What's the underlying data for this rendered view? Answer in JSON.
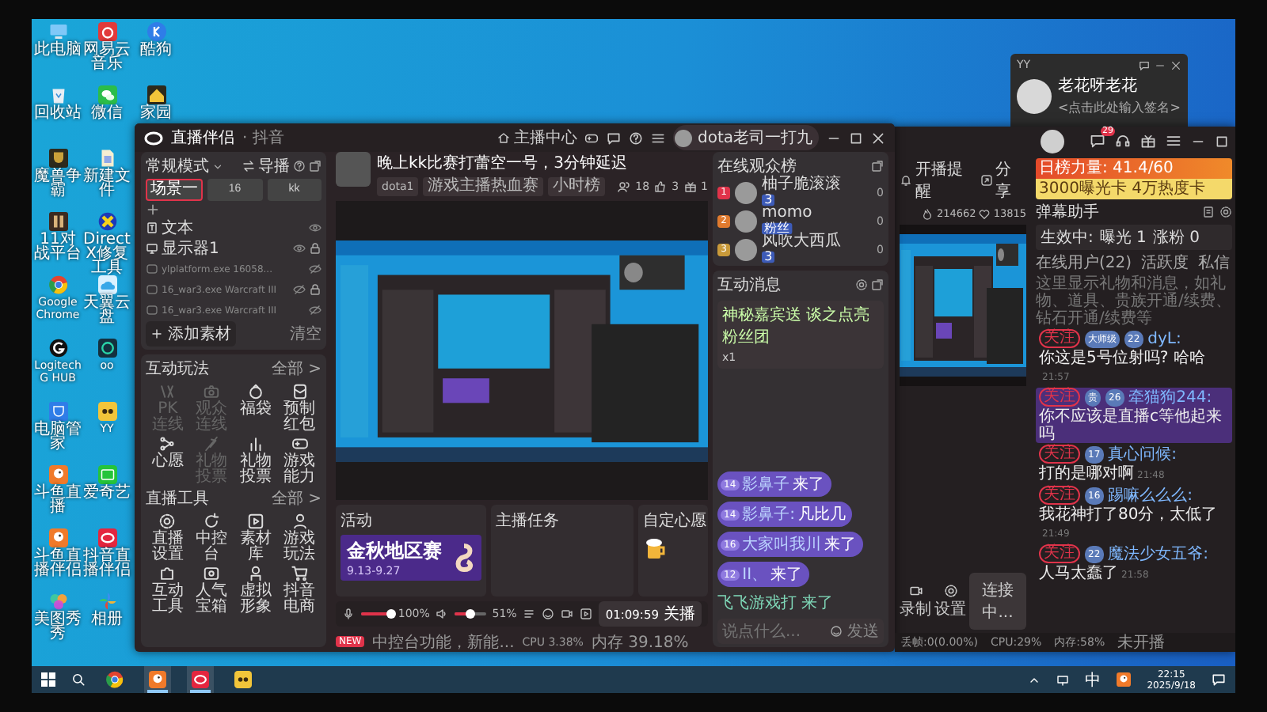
{
  "desktop": {
    "icons": [
      {
        "label": "此电脑",
        "kind": "computer"
      },
      {
        "label": "回收站",
        "kind": "bin"
      },
      {
        "label": "魔兽争霸",
        "kind": "shieldgame"
      },
      {
        "label": "11对战平台",
        "kind": "tile"
      },
      {
        "label": "Google Chrome",
        "kind": "browser"
      },
      {
        "label": "Logitech G HUB",
        "kind": "roundlogo"
      },
      {
        "label": "电脑管家",
        "kind": "guard"
      },
      {
        "label": "斗鱼直播",
        "kind": "bird"
      },
      {
        "label": "斗鱼直播伴侣",
        "kind": "bird"
      },
      {
        "label": "美图秀秀",
        "kind": "petal"
      },
      {
        "label": "网易云音乐",
        "kind": "music"
      },
      {
        "label": "微信",
        "kind": "chat"
      },
      {
        "label": "新建文件",
        "kind": "file"
      },
      {
        "label": "DirectX修复工具",
        "kind": "cross"
      },
      {
        "label": "天翼云盘",
        "kind": "cloud"
      },
      {
        "label": "oo",
        "kind": "ring"
      },
      {
        "label": "YY",
        "kind": "animal"
      },
      {
        "label": "爱奇艺",
        "kind": "tv"
      },
      {
        "label": "抖音直播伴侣",
        "kind": "oval"
      },
      {
        "label": "相册",
        "kind": "pinwheel"
      },
      {
        "label": "酷狗",
        "kind": "badge"
      },
      {
        "label": "家园",
        "kind": "house"
      }
    ]
  },
  "profile_card": {
    "app": "YY",
    "name": "老花呀老花",
    "signature": "<点击此处输入签名>"
  },
  "main_window": {
    "app_title": "直播伴侣",
    "platform": "· 抖音",
    "anchor_center": "主播中心",
    "user": "dota老司一打九",
    "scenes": {
      "mode": "常规模式",
      "director": "导播",
      "tabs": [
        {
          "label": "场景一",
          "selected": true
        },
        {
          "label": "16",
          "selected": false
        },
        {
          "label": "kk",
          "selected": false
        }
      ],
      "sources": [
        {
          "kind": "text",
          "label": "文本",
          "visible": true,
          "locked": false
        },
        {
          "kind": "display",
          "label": "显示器1",
          "visible": true,
          "locked": true
        },
        {
          "kind": "window",
          "label": "ylplatform.exe 16058...",
          "visible": false,
          "locked": false
        },
        {
          "kind": "window",
          "label": "16_war3.exe Warcraft III",
          "visible": false,
          "locked": true
        },
        {
          "kind": "window",
          "label": "16_war3.exe Warcraft III",
          "visible": false,
          "locked": false
        }
      ],
      "add": "添加素材",
      "clear": "清空"
    },
    "interactive": {
      "title": "互动玩法",
      "more": "全部 >",
      "tools": [
        {
          "label": "PK连线",
          "kind": "versus",
          "disabled": true
        },
        {
          "label": "观众连线",
          "kind": "camera",
          "disabled": true
        },
        {
          "label": "福袋",
          "kind": "bag",
          "disabled": false
        },
        {
          "label": "预制红包",
          "kind": "envelope",
          "disabled": false
        },
        {
          "label": "心愿",
          "kind": "network",
          "disabled": false
        },
        {
          "label": "礼物投票",
          "kind": "quill",
          "disabled": true
        },
        {
          "label": "礼物投票",
          "kind": "bars",
          "disabled": false
        },
        {
          "label": "游戏能力",
          "kind": "gamepad",
          "disabled": false
        }
      ]
    },
    "live_tools": {
      "title": "直播工具",
      "more": "全部 >",
      "tools": [
        {
          "label": "直播设置",
          "kind": "gear",
          "disabled": false
        },
        {
          "label": "中控台",
          "kind": "refresh",
          "disabled": false
        },
        {
          "label": "素材库",
          "kind": "video",
          "disabled": false
        },
        {
          "label": "游戏玩法",
          "kind": "person",
          "disabled": false
        },
        {
          "label": "互动工具",
          "kind": "puzzle",
          "disabled": false
        },
        {
          "label": "人气宝箱",
          "kind": "chest",
          "disabled": false
        },
        {
          "label": "虚拟形象",
          "kind": "figure",
          "disabled": false
        },
        {
          "label": "抖音电商",
          "kind": "cart",
          "disabled": false
        }
      ]
    },
    "room": {
      "title": "晚上kk比赛打蕾空一号，3分钟延迟",
      "tags": [
        "dota1",
        "游戏主播热血赛",
        "小时榜"
      ],
      "viewers": "18",
      "likes": "3",
      "gifts": "1"
    },
    "activity": {
      "title": "活动",
      "banner_title": "金秋地区赛",
      "banner_dates": "9.13-9.27"
    },
    "task": {
      "title": "主播任务"
    },
    "wish": {
      "title": "自定心愿"
    },
    "controls": {
      "mic": {
        "level": 1.0,
        "reading": "100%"
      },
      "speaker": {
        "level": 0.51,
        "reading": "51%"
      },
      "timer": "01:09:59",
      "end": "关播"
    },
    "status": {
      "badge": "NEW",
      "notice": "中控台功能，新能...",
      "cpu": "CPU 3.38%",
      "memory": "内存 39.18%"
    },
    "audience": {
      "title": "在线观众榜",
      "rows": [
        {
          "rank": "1",
          "color": "#e0334a",
          "name": "柚子脆滚滚",
          "badge": "3",
          "score": "0"
        },
        {
          "rank": "2",
          "color": "#e07a2e",
          "name": "momo",
          "badge": "粉丝",
          "score": "0"
        },
        {
          "rank": "3",
          "color": "#c99a3a",
          "name": "风吹大西瓜",
          "badge": "3",
          "score": "0"
        }
      ]
    },
    "messages": {
      "title": "互动消息",
      "gift": "神秘嘉宾送 谈之点亮粉丝团",
      "gift_count": "x1",
      "chat": [
        {
          "badge": "14",
          "user": "影鼻子",
          "text": "来了"
        },
        {
          "badge": "14",
          "user": "影鼻子:",
          "text": "凡比几"
        },
        {
          "badge": "16",
          "user": "大家叫我川",
          "text": "来了"
        },
        {
          "badge": "12",
          "user": "II、",
          "text": "来了"
        }
      ],
      "last": "飞飞游戏打 来了",
      "placeholder": "说点什么...",
      "send": "发送"
    }
  },
  "side_window": {
    "mail_badge": "29",
    "remind": "开播提醒",
    "share": "分享",
    "likes": "214662",
    "fans": "13815",
    "power": "日榜力量: 41.4/60",
    "reward": "3000曝光卡 4万热度卡",
    "assistant": "弹幕助手",
    "active": "生效中:",
    "exposure": "曝光 1",
    "gain": "涨粉 0",
    "tabs": [
      "在线用户(22)",
      "活跃度",
      "私信"
    ],
    "hint": "这里显示礼物和消息，如礼物、道具、贵族开通/续费、钻石开通/续费等",
    "chat": [
      {
        "follow": "关注",
        "badges": [
          "大师级",
          "22"
        ],
        "user": "dyL:",
        "text": "你这是5号位射吗? 哈哈",
        "time": "21:57",
        "highlighted": false
      },
      {
        "follow": "关注",
        "badges": [
          "贵",
          "26"
        ],
        "user": "牵猫狗244:",
        "text": "你不应该是直播c等他起来吗",
        "highlighted": true
      },
      {
        "follow": "关注",
        "badges": [
          "17"
        ],
        "user": "真心问候:",
        "text": "打的是哪对啊",
        "time": "21:48",
        "highlighted": false
      },
      {
        "follow": "关注",
        "badges": [
          "16"
        ],
        "user": "踢嘛么么么:",
        "text": "我花神打了80分，太低了",
        "time": "21:49",
        "highlighted": false
      },
      {
        "follow": "关注",
        "badges": [
          "22"
        ],
        "user": "魔法少女五爷:",
        "text": "人马太蠢了",
        "time": "21:58",
        "highlighted": false
      }
    ],
    "connect": "连接中...",
    "record": "录制",
    "settings": "设置",
    "status": [
      "丢帧:0(0.00%)",
      "CPU:29%",
      "内存:58%",
      "未开播"
    ]
  },
  "taskbar": {
    "apps": [
      {
        "kind": "browser",
        "open": false
      },
      {
        "kind": "bird",
        "open": true
      },
      {
        "kind": "oval",
        "open": true
      },
      {
        "kind": "animal",
        "open": false
      }
    ],
    "ime": "中",
    "time": "22:15",
    "date": "2025/9/18"
  }
}
